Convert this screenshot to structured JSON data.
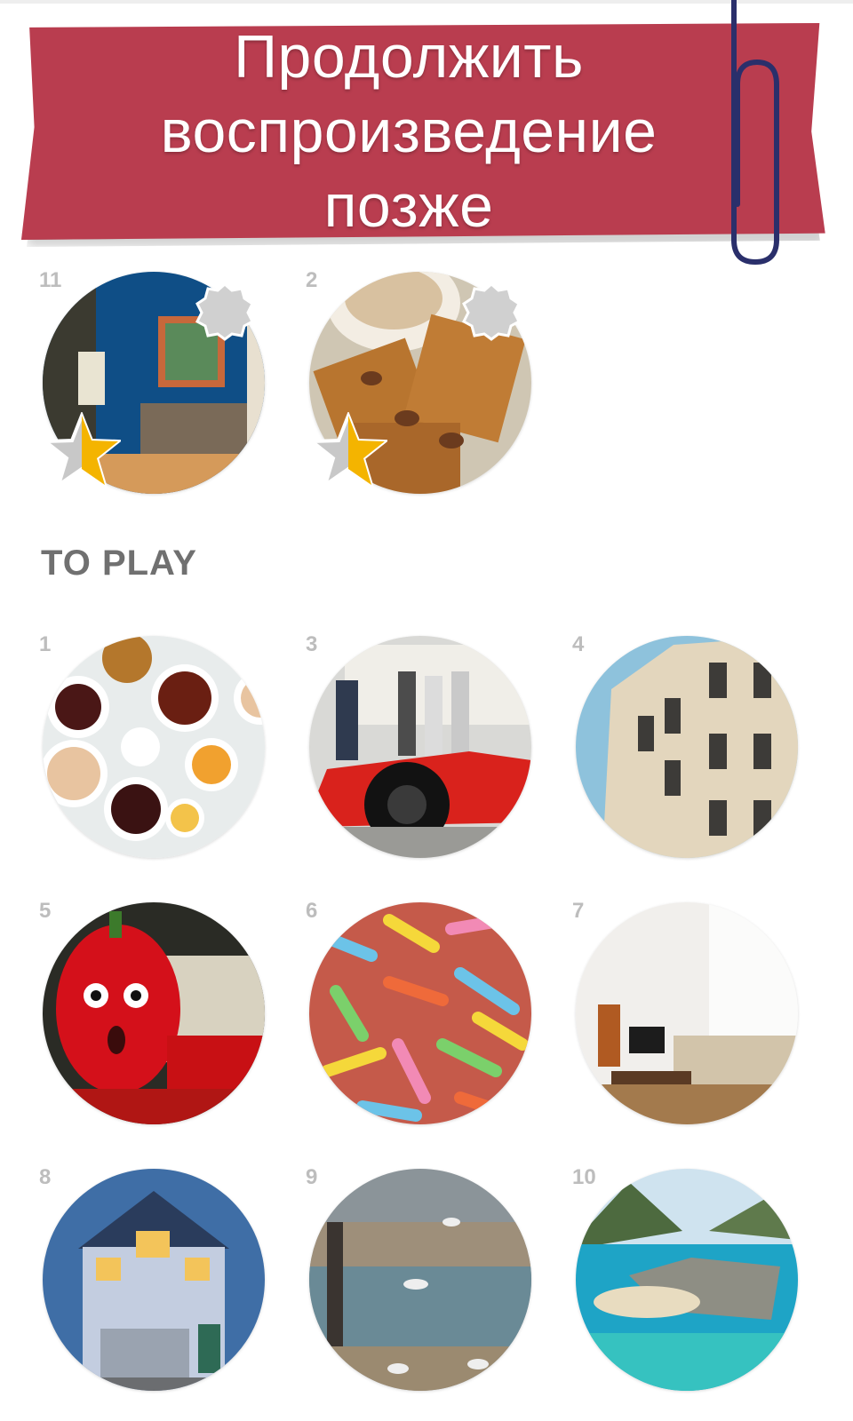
{
  "banner": {
    "line1": "Продолжить",
    "line2": "воспроизведение",
    "line3": "позже",
    "color": "#b93d4f"
  },
  "continue_levels": [
    {
      "number": "11",
      "subject": "blue living room",
      "star_progress": 0.5,
      "badge_icon": "seal-icon"
    },
    {
      "number": "2",
      "subject": "waffles with coffee",
      "star_progress": 0.5,
      "badge_icon": "seal-icon"
    }
  ],
  "section": {
    "title": "TO PLAY"
  },
  "to_play_levels": [
    {
      "number": "1",
      "subject": "cups of tea"
    },
    {
      "number": "3",
      "subject": "red race car"
    },
    {
      "number": "4",
      "subject": "building facade"
    },
    {
      "number": "5",
      "subject": "red pepper face"
    },
    {
      "number": "6",
      "subject": "gummy worms"
    },
    {
      "number": "7",
      "subject": "white living room"
    },
    {
      "number": "8",
      "subject": "blue house"
    },
    {
      "number": "9",
      "subject": "seagulls harbor"
    },
    {
      "number": "10",
      "subject": "island lagoon"
    }
  ]
}
